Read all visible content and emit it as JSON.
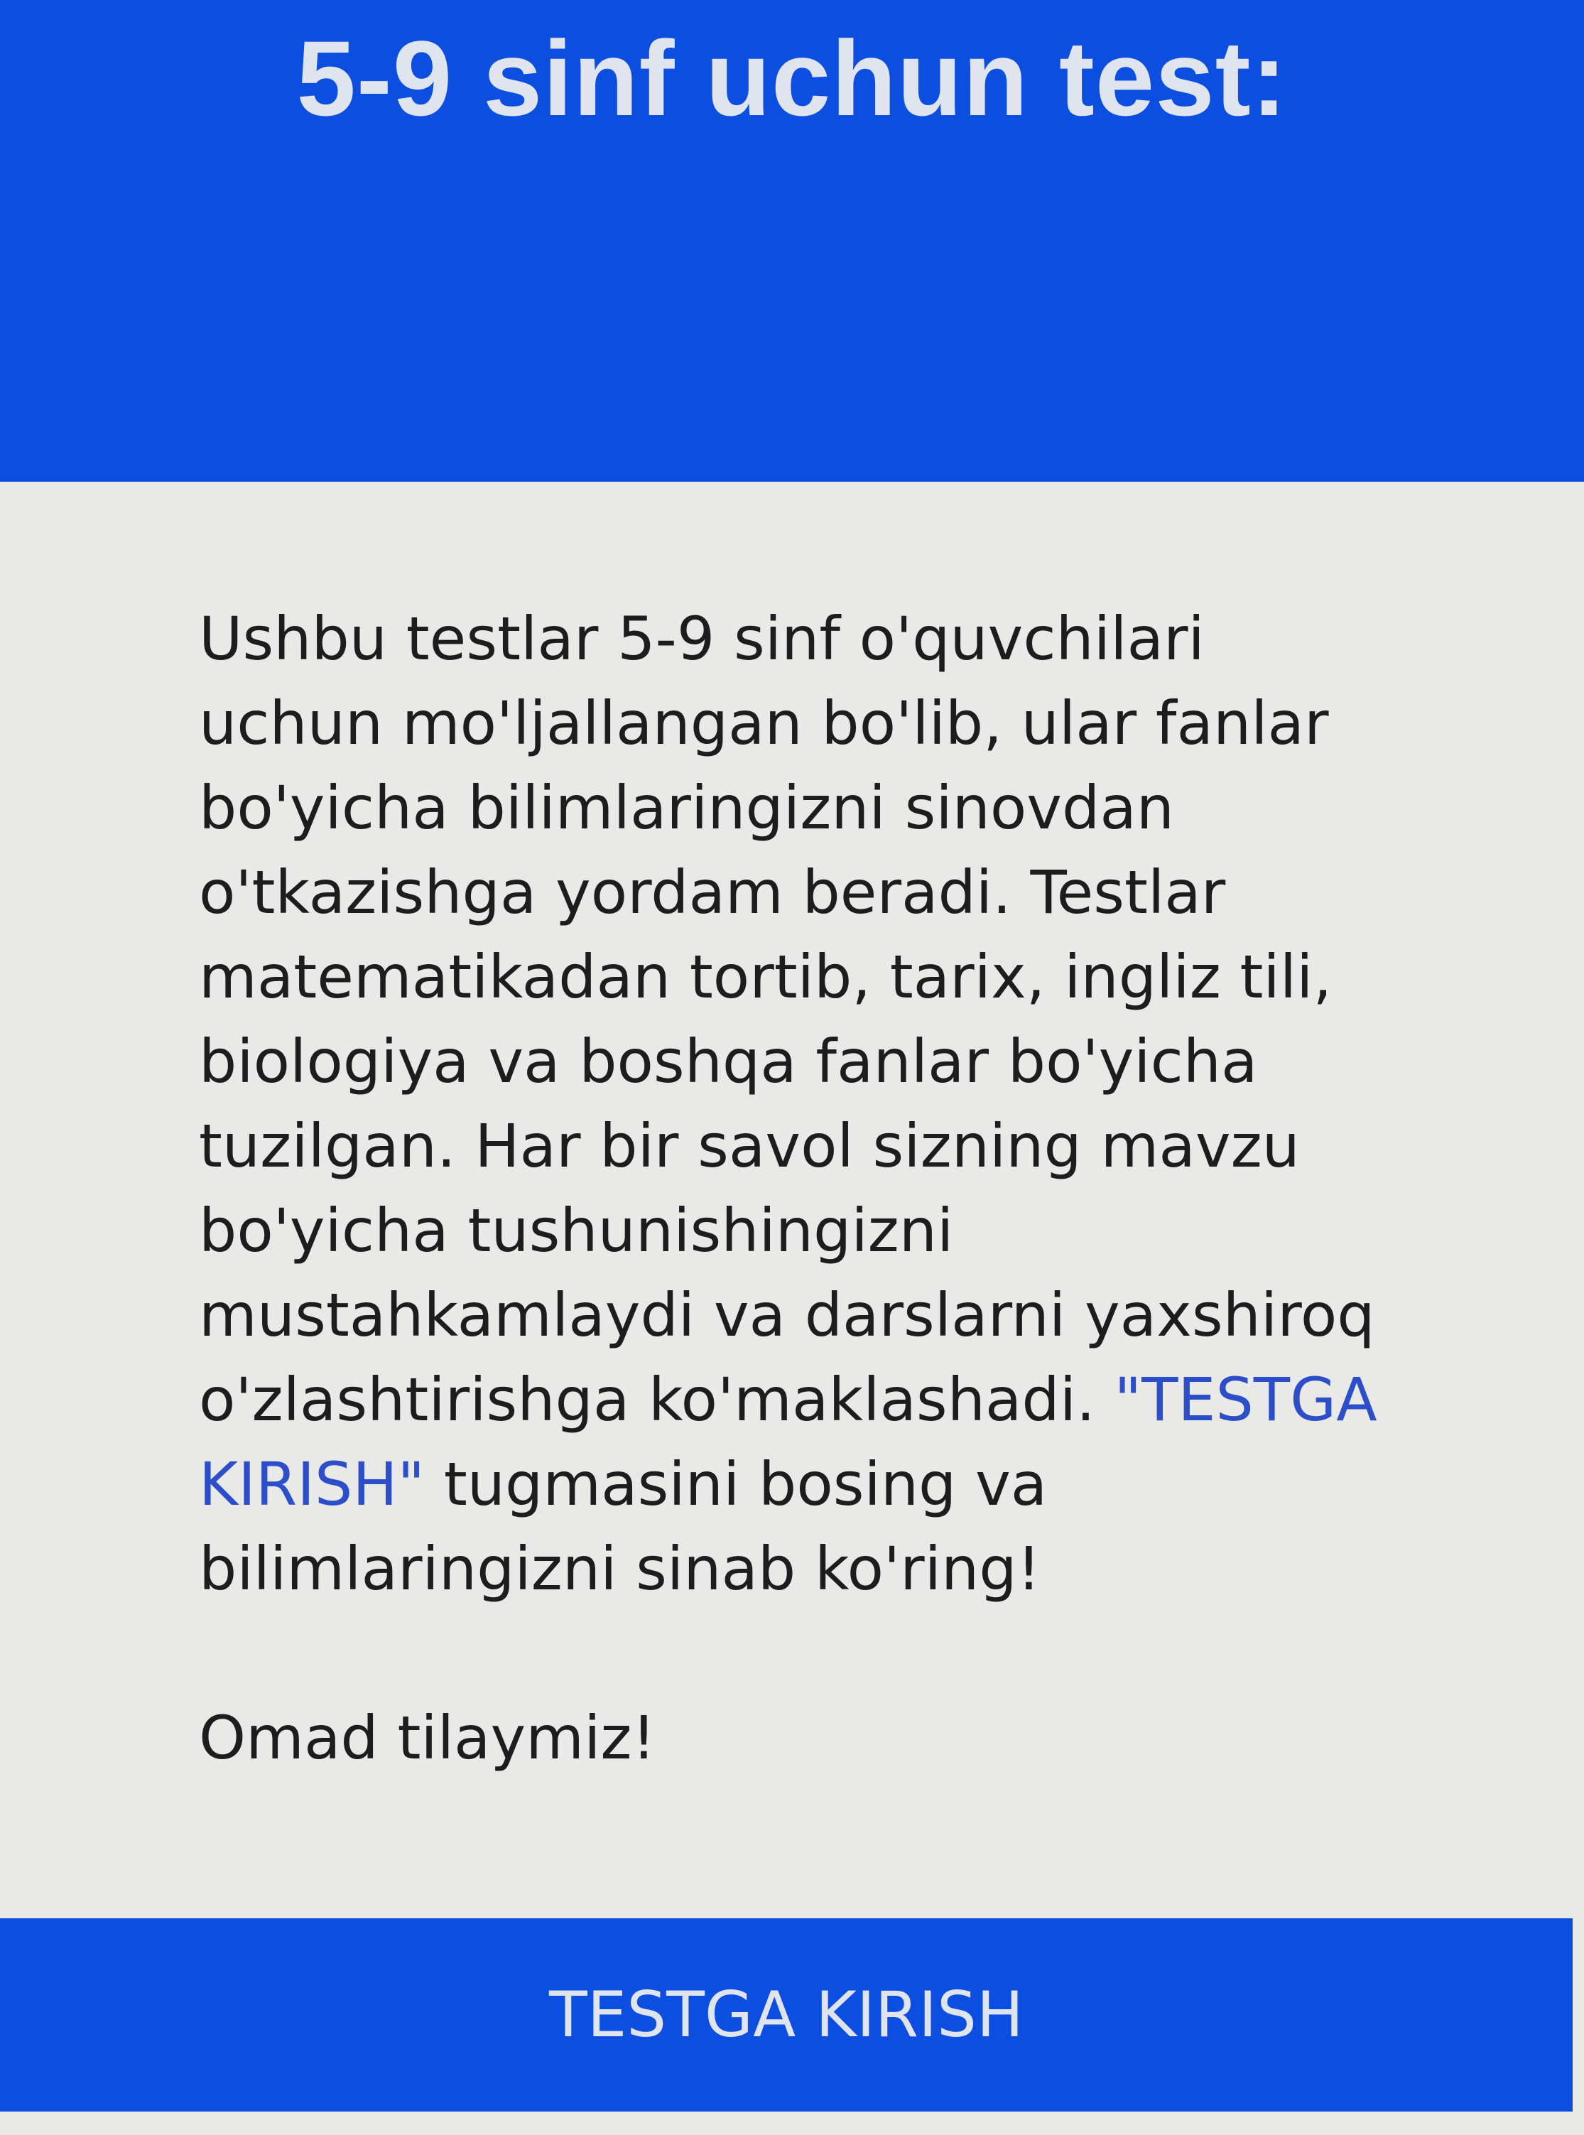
{
  "header": {
    "title": "5-9 sinf uchun test:"
  },
  "content": {
    "paragraph_before_link": "Ushbu testlar 5-9 sinf o'quvchilari uchun mo'ljallangan bo'lib, ular fanlar bo'yicha bilimlaringizni sinovdan o'tkazishga yordam beradi. Testlar matematikadan tortib, tarix, ingliz tili, biologiya va boshqa fanlar bo'yicha tuzilgan. Har bir savol sizning mavzu bo'yicha tushunishingizni mustahkamlaydi va darslarni yaxshiroq o'zlashtirishga ko'maklashadi. ",
    "inline_link_text": "\"TESTGA KIRISH\"",
    "paragraph_after_link": " tugmasini bosing va bilimlaringizni sinab ko'ring!",
    "closing": "Omad tilaymiz!"
  },
  "button": {
    "label": "TESTGA KIRISH"
  },
  "colors": {
    "primary_blue": "#0c4fe0",
    "background": "#e9e9e7",
    "text": "#1d1d1d",
    "link": "#2c4fc9",
    "on_primary_text": "#dfe4ee"
  }
}
